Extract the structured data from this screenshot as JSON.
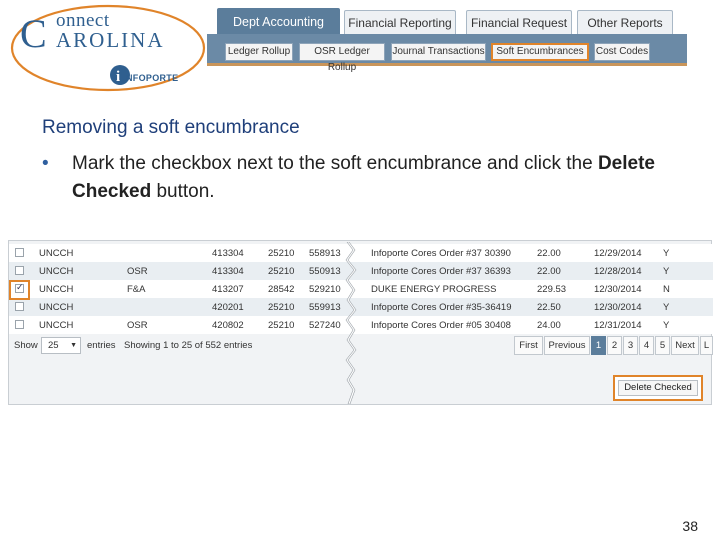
{
  "logo": {
    "connect": "onnect",
    "carolina": "AROLINA",
    "infoporte": "NFOPORTE",
    "colors": {
      "blue": "#2f5f8f",
      "orange": "#e0842a"
    }
  },
  "nav": {
    "main_tabs": [
      {
        "label": "Dept Accounting",
        "active": true
      },
      {
        "label": "Financial Reporting",
        "active": false
      },
      {
        "label": "Financial Request",
        "active": false
      },
      {
        "label": "Other Reports",
        "active": false
      }
    ],
    "sub_tabs": [
      {
        "label": "Ledger Rollup",
        "active": false
      },
      {
        "label": "OSR Ledger Rollup",
        "active": false
      },
      {
        "label": "Journal Transactions",
        "active": false
      },
      {
        "label": "Soft Encumbrances",
        "active": true
      },
      {
        "label": "Cost Codes",
        "active": false
      }
    ]
  },
  "slide": {
    "heading": "Removing a soft encumbrance",
    "bullet_pre": "Mark the checkbox next to the soft encumbrance and click the ",
    "bullet_bold": "Delete Checked",
    "bullet_post": " button."
  },
  "table": {
    "rows": [
      {
        "checked": false,
        "entity": "UNCCH",
        "type": "",
        "account": "413304",
        "code": "25210",
        "ref": "558913",
        "description": "Infoporte Cores Order #37 30390",
        "amount": "22.00",
        "date": "12/29/2014",
        "flag": "Y"
      },
      {
        "checked": false,
        "entity": "UNCCH",
        "type": "OSR",
        "account": "413304",
        "code": "25210",
        "ref": "550913",
        "description": "Infoporte Cores Order #37 36393",
        "amount": "22.00",
        "date": "12/28/2014",
        "flag": "Y"
      },
      {
        "checked": true,
        "entity": "UNCCH",
        "type": "F&A",
        "account": "413207",
        "code": "28542",
        "ref": "529210",
        "description": "DUKE ENERGY PROGRESS",
        "amount": "229.53",
        "date": "12/30/2014",
        "flag": "N"
      },
      {
        "checked": false,
        "entity": "UNCCH",
        "type": "",
        "account": "420201",
        "code": "25210",
        "ref": "559913",
        "description": "Infoporte Cores Order #35-36419",
        "amount": "22.50",
        "date": "12/30/2014",
        "flag": "Y"
      },
      {
        "checked": false,
        "entity": "UNCCH",
        "type": "OSR",
        "account": "420802",
        "code": "25210",
        "ref": "527240",
        "description": "Infoporte Cores Order #05 30408",
        "amount": "24.00",
        "date": "12/31/2014",
        "flag": "Y"
      }
    ],
    "pager": {
      "show_label": "Show",
      "show_value": "25",
      "entries_label": "entries",
      "info": "Showing 1 to 25 of 552 entries",
      "buttons": [
        "First",
        "Previous",
        "1",
        "2",
        "3",
        "4",
        "5",
        "Next",
        "L"
      ],
      "current": "1"
    },
    "delete_button": "Delete Checked"
  },
  "page_number": "38"
}
